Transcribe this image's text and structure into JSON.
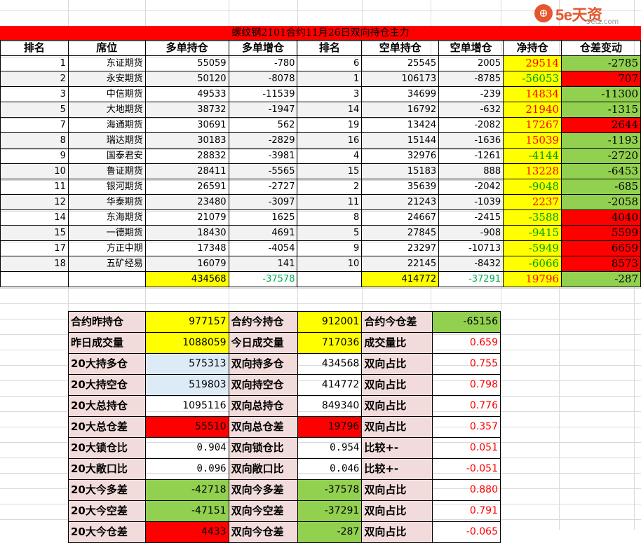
{
  "logo": {
    "badge": "⊕",
    "name": "5e天资",
    "site": "5etz.com"
  },
  "title": "螺纹钢2101合约11月26日双向持仓主力",
  "headers": [
    "排名",
    "席位",
    "多单持仓",
    "多单增仓",
    "排名",
    "空单持仓",
    "空单增仓",
    "净持仓",
    "仓差变动"
  ],
  "rows": [
    {
      "rank": "1",
      "seat": "东证期货",
      "long": "55059",
      "long_chg": "-780",
      "srank": "6",
      "short": "25545",
      "short_chg": "2005",
      "net": "29514",
      "net_color": "red",
      "diff": "-2785",
      "diff_bg": "green"
    },
    {
      "rank": "2",
      "seat": "永安期货",
      "long": "50120",
      "long_chg": "-8078",
      "srank": "1",
      "short": "106173",
      "short_chg": "-8785",
      "net": "-56053",
      "net_color": "green",
      "diff": "707",
      "diff_bg": "red"
    },
    {
      "rank": "3",
      "seat": "中信期货",
      "long": "49533",
      "long_chg": "-11539",
      "srank": "3",
      "short": "34699",
      "short_chg": "-239",
      "net": "14834",
      "net_color": "red",
      "diff": "-11300",
      "diff_bg": "green"
    },
    {
      "rank": "5",
      "seat": "大地期货",
      "long": "38732",
      "long_chg": "-1947",
      "srank": "14",
      "short": "16792",
      "short_chg": "-632",
      "net": "21940",
      "net_color": "red",
      "diff": "-1315",
      "diff_bg": "green"
    },
    {
      "rank": "7",
      "seat": "海通期货",
      "long": "30691",
      "long_chg": "562",
      "srank": "19",
      "short": "13424",
      "short_chg": "-2082",
      "net": "17267",
      "net_color": "red",
      "diff": "2644",
      "diff_bg": "red"
    },
    {
      "rank": "8",
      "seat": "瑞达期货",
      "long": "30183",
      "long_chg": "-2829",
      "srank": "16",
      "short": "15144",
      "short_chg": "-1636",
      "net": "15039",
      "net_color": "red",
      "diff": "-1193",
      "diff_bg": "green"
    },
    {
      "rank": "9",
      "seat": "国泰君安",
      "long": "28832",
      "long_chg": "-3981",
      "srank": "4",
      "short": "32976",
      "short_chg": "-1261",
      "net": "-4144",
      "net_color": "green",
      "diff": "-2720",
      "diff_bg": "green"
    },
    {
      "rank": "10",
      "seat": "鲁证期货",
      "long": "28411",
      "long_chg": "-5565",
      "srank": "15",
      "short": "15183",
      "short_chg": "888",
      "net": "13228",
      "net_color": "red",
      "diff": "-6453",
      "diff_bg": "green"
    },
    {
      "rank": "11",
      "seat": "银河期货",
      "long": "26591",
      "long_chg": "-2727",
      "srank": "2",
      "short": "35639",
      "short_chg": "-2042",
      "net": "-9048",
      "net_color": "green",
      "diff": "-685",
      "diff_bg": "green"
    },
    {
      "rank": "12",
      "seat": "华泰期货",
      "long": "23480",
      "long_chg": "-3097",
      "srank": "11",
      "short": "21243",
      "short_chg": "-1039",
      "net": "2237",
      "net_color": "red",
      "diff": "-2058",
      "diff_bg": "green"
    },
    {
      "rank": "14",
      "seat": "东海期货",
      "long": "21079",
      "long_chg": "1625",
      "srank": "8",
      "short": "24667",
      "short_chg": "-2415",
      "net": "-3588",
      "net_color": "green",
      "diff": "4040",
      "diff_bg": "red"
    },
    {
      "rank": "15",
      "seat": "一德期货",
      "long": "18430",
      "long_chg": "4691",
      "srank": "5",
      "short": "27845",
      "short_chg": "-908",
      "net": "-9415",
      "net_color": "green",
      "diff": "5599",
      "diff_bg": "red"
    },
    {
      "rank": "17",
      "seat": "方正中期",
      "long": "17348",
      "long_chg": "-4054",
      "srank": "9",
      "short": "23297",
      "short_chg": "-10713",
      "net": "-5949",
      "net_color": "green",
      "diff": "6659",
      "diff_bg": "red"
    },
    {
      "rank": "18",
      "seat": "五矿经易",
      "long": "16079",
      "long_chg": "141",
      "srank": "10",
      "short": "22145",
      "short_chg": "-8432",
      "net": "-6066",
      "net_color": "green",
      "diff": "8573",
      "diff_bg": "red"
    }
  ],
  "totals": {
    "long": "434568",
    "long_chg": "-37578",
    "short": "414772",
    "short_chg": "-37291",
    "net": "19796",
    "diff": "-287"
  },
  "summary": [
    [
      {
        "t": "合约昨持仓",
        "c": "pink",
        "lbl": true
      },
      {
        "t": "977157",
        "c": "yel"
      },
      {
        "t": "合约今持仓",
        "c": "pink",
        "lbl": true
      },
      {
        "t": "912001",
        "c": "yel"
      },
      {
        "t": "合约今仓差",
        "c": "pink",
        "lbl": true
      },
      {
        "t": "-65156",
        "c": "grn"
      }
    ],
    [
      {
        "t": "昨日成交量",
        "c": "pink",
        "lbl": true
      },
      {
        "t": "1088059",
        "c": "yel"
      },
      {
        "t": "今日成交量",
        "c": "pink",
        "lbl": true
      },
      {
        "t": "717036",
        "c": "yel"
      },
      {
        "t": "成交量比",
        "c": "pink",
        "lbl": true
      },
      {
        "t": "0.659",
        "c": "",
        "txt": "red"
      }
    ],
    [
      {
        "t": "20大持多仓",
        "c": "pink",
        "lbl": true
      },
      {
        "t": "575313",
        "c": "lblue"
      },
      {
        "t": "双向持多仓",
        "c": "pink",
        "lbl": true
      },
      {
        "t": "434568",
        "c": ""
      },
      {
        "t": "双向占比",
        "c": "pink",
        "lbl": true
      },
      {
        "t": "0.755",
        "c": "",
        "txt": "red"
      }
    ],
    [
      {
        "t": "20大持空仓",
        "c": "pink",
        "lbl": true
      },
      {
        "t": "519803",
        "c": "lblue"
      },
      {
        "t": "双向持空仓",
        "c": "pink",
        "lbl": true
      },
      {
        "t": "414772",
        "c": ""
      },
      {
        "t": "双向占比",
        "c": "pink",
        "lbl": true
      },
      {
        "t": "0.798",
        "c": "",
        "txt": "red"
      }
    ],
    [
      {
        "t": "20大总持仓",
        "c": "pink",
        "lbl": true
      },
      {
        "t": "1095116",
        "c": ""
      },
      {
        "t": "双向总持仓",
        "c": "pink",
        "lbl": true
      },
      {
        "t": "849340",
        "c": ""
      },
      {
        "t": "双向占比",
        "c": "pink",
        "lbl": true
      },
      {
        "t": "0.776",
        "c": "",
        "txt": "red"
      }
    ],
    [
      {
        "t": "20大总仓差",
        "c": "pink",
        "lbl": true
      },
      {
        "t": "55510",
        "c": "red"
      },
      {
        "t": "双向总仓差",
        "c": "pink",
        "lbl": true
      },
      {
        "t": "19796",
        "c": "red"
      },
      {
        "t": "双向占比",
        "c": "pink",
        "lbl": true
      },
      {
        "t": "0.357",
        "c": "",
        "txt": "red"
      }
    ],
    [
      {
        "t": "20大锁仓比",
        "c": "pink",
        "lbl": true
      },
      {
        "t": "0.904",
        "c": "",
        "mono": true
      },
      {
        "t": "双向锁仓比",
        "c": "pink",
        "lbl": true
      },
      {
        "t": "0.954",
        "c": "",
        "mono": true
      },
      {
        "t": "比较+-",
        "c": "pink",
        "lbl": true
      },
      {
        "t": "0.051",
        "c": "",
        "txt": "red"
      }
    ],
    [
      {
        "t": "20大敞口比",
        "c": "pink",
        "lbl": true
      },
      {
        "t": "0.096",
        "c": "",
        "mono": true
      },
      {
        "t": "双向敞口比",
        "c": "pink",
        "lbl": true
      },
      {
        "t": "0.046",
        "c": "",
        "mono": true
      },
      {
        "t": "比较+-",
        "c": "pink",
        "lbl": true
      },
      {
        "t": "-0.051",
        "c": "",
        "txt": "red"
      }
    ],
    [
      {
        "t": "20大今多差",
        "c": "pink",
        "lbl": true
      },
      {
        "t": "-42718",
        "c": "grn"
      },
      {
        "t": "双向今多差",
        "c": "pink",
        "lbl": true
      },
      {
        "t": "-37578",
        "c": "grn"
      },
      {
        "t": "双向占比",
        "c": "pink",
        "lbl": true
      },
      {
        "t": "0.880",
        "c": "",
        "txt": "red"
      }
    ],
    [
      {
        "t": "20大今空差",
        "c": "pink",
        "lbl": true
      },
      {
        "t": "-47151",
        "c": "grn"
      },
      {
        "t": "双向今空差",
        "c": "pink",
        "lbl": true
      },
      {
        "t": "-37291",
        "c": "grn"
      },
      {
        "t": "双向占比",
        "c": "pink",
        "lbl": true
      },
      {
        "t": "0.791",
        "c": "",
        "txt": "red"
      }
    ],
    [
      {
        "t": "20大今仓差",
        "c": "pink",
        "lbl": true
      },
      {
        "t": "4433",
        "c": "red"
      },
      {
        "t": "双向今仓差",
        "c": "pink",
        "lbl": true
      },
      {
        "t": "-287",
        "c": "grn"
      },
      {
        "t": "双向占比",
        "c": "pink",
        "lbl": true
      },
      {
        "t": "-0.065",
        "c": "",
        "txt": "red"
      }
    ]
  ]
}
